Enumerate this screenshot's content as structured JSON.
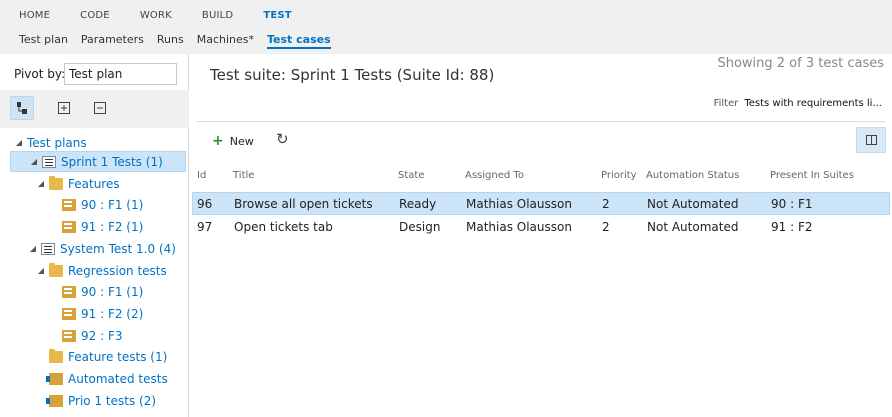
{
  "nav": {
    "primary": [
      "HOME",
      "CODE",
      "WORK",
      "BUILD",
      "TEST"
    ],
    "primary_active": "TEST",
    "secondary": [
      "Test plan",
      "Parameters",
      "Runs",
      "Machines*",
      "Test cases"
    ],
    "secondary_active": "Test cases"
  },
  "left": {
    "pivot_label": "Pivot by:",
    "pivot_value": "Test plan",
    "tree": [
      {
        "label": "Test plans",
        "icon": "none",
        "expanded": true,
        "selected": false
      },
      {
        "label": "Sprint 1 Tests (1)",
        "icon": "suite-icon",
        "expanded": true,
        "selected": true
      },
      {
        "label": "Features",
        "icon": "folder-icon",
        "expanded": true,
        "selected": false
      },
      {
        "label": "90 : F1 (1)",
        "icon": "requirement-suite-icon",
        "expanded": false,
        "selected": false
      },
      {
        "label": "91 : F2 (1)",
        "icon": "requirement-suite-icon",
        "expanded": false,
        "selected": false
      },
      {
        "label": "System Test 1.0 (4)",
        "icon": "suite-icon",
        "expanded": true,
        "selected": false
      },
      {
        "label": "Regression tests",
        "icon": "folder-icon",
        "expanded": true,
        "selected": false
      },
      {
        "label": "90 : F1 (1)",
        "icon": "requirement-suite-icon",
        "expanded": false,
        "selected": false
      },
      {
        "label": "91 : F2 (2)",
        "icon": "requirement-suite-icon",
        "expanded": false,
        "selected": false
      },
      {
        "label": "92 : F3",
        "icon": "requirement-suite-icon",
        "expanded": false,
        "selected": false
      },
      {
        "label": "Feature tests (1)",
        "icon": "folder-icon",
        "expanded": false,
        "selected": false
      },
      {
        "label": "Automated tests",
        "icon": "query-suite-icon",
        "expanded": false,
        "selected": false
      },
      {
        "label": "Prio 1 tests (2)",
        "icon": "query-suite-icon",
        "expanded": false,
        "selected": false
      }
    ]
  },
  "main": {
    "title": "Test suite: Sprint 1 Tests (Suite Id: 88)",
    "showing": "Showing 2 of 3 test cases",
    "filter_label": "Filter",
    "filter_value": "Tests with requirements li...",
    "new_label": "New",
    "columns": [
      "Id",
      "Title",
      "State",
      "Assigned To",
      "Priority",
      "Automation Status",
      "Present In Suites"
    ],
    "rows": [
      {
        "id": "96",
        "title": "Browse all open tickets",
        "state": "Ready",
        "assigned": "Mathias Olausson",
        "priority": "2",
        "automation": "Not Automated",
        "suites": "90 : F1"
      },
      {
        "id": "97",
        "title": "Open tickets tab",
        "state": "Design",
        "assigned": "Mathias Olausson",
        "priority": "2",
        "automation": "Not Automated",
        "suites": "91 : F2"
      }
    ]
  },
  "colors": {
    "accent": "#0072c6",
    "selection": "#cce4f7",
    "navbar": "#f0f0f0"
  }
}
